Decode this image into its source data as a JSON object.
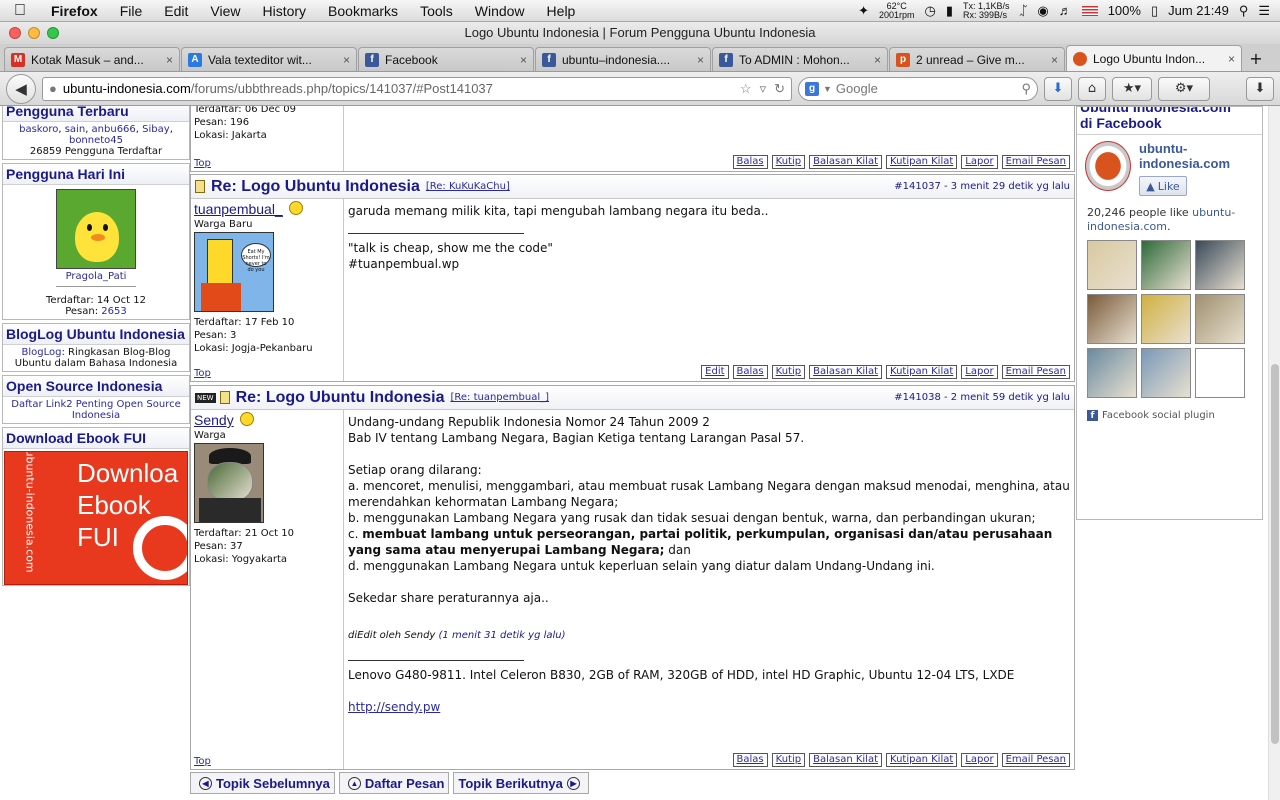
{
  "menubar": {
    "app": "Firefox",
    "items": [
      "File",
      "Edit",
      "View",
      "History",
      "Bookmarks",
      "Tools",
      "Window",
      "Help"
    ],
    "temp": "62°C",
    "rpm": "2001rpm",
    "tx_label": "Tx:",
    "tx": "1,1KB/s",
    "rx_label": "Rx:",
    "rx": "399B/s",
    "battery": "100%",
    "clock": "Jum 21:49"
  },
  "window": {
    "title": "Logo Ubuntu Indonesia | Forum Pengguna Ubuntu Indonesia"
  },
  "tabs": [
    {
      "label": "Kotak Masuk – and...",
      "fav": "M",
      "color": "#d93025"
    },
    {
      "label": "Vala texteditor wit...",
      "fav": "A",
      "color": "#2a7ae2"
    },
    {
      "label": "Facebook",
      "fav": "f",
      "color": "#3b5998"
    },
    {
      "label": "ubuntu–indonesia....",
      "fav": "f",
      "color": "#3b5998"
    },
    {
      "label": "To ADMIN : Mohon...",
      "fav": "f",
      "color": "#3b5998"
    },
    {
      "label": "2 unread – Give m...",
      "fav": "p",
      "color": "#d8531e"
    },
    {
      "label": "Logo Ubuntu Indon...",
      "fav": "",
      "color": "#d8531e"
    }
  ],
  "nav": {
    "url_domain": "ubuntu-indonesia.com",
    "url_path": "/forums/ubbthreads.php/topics/141037/#Post141037",
    "search_placeholder": "Google"
  },
  "left": {
    "newest": {
      "title": "Pengguna Terbaru",
      "users": [
        "baskoro",
        "sain",
        "anbu666",
        "Sibay",
        "bonneto45"
      ],
      "count": "26859 Pengguna Terdaftar"
    },
    "today": {
      "title": "Pengguna Hari Ini",
      "user": "Pragola_Pati",
      "joined": "Terdaftar: 14 Oct 12",
      "posts_label": "Pesan:",
      "posts": "2653"
    },
    "bloglog": {
      "title": "BlogLog Ubuntu Indonesia",
      "link": "BlogLog",
      "text": ": Ringkasan Blog-Blog Ubuntu dalam Bahasa Indonesia"
    },
    "opensource": {
      "title": "Open Source Indonesia",
      "link": "Daftar Link2 Penting Open Source Indonesia"
    },
    "ebook": {
      "title": "Download Ebook FUI",
      "line1": "Downloa",
      "line2": "Ebook",
      "line3": "FUI",
      "side": "ubuntu-indonesia.com"
    }
  },
  "post0": {
    "joined": "Terdaftar: 06 Dec 09",
    "posts": "Pesan: 196",
    "location": "Lokasi: Jakarta",
    "top": "Top"
  },
  "post1": {
    "title": "Re: Logo Ubuntu Indonesia",
    "reply": "[Re: KuKuKaChu]",
    "meta": "#141037 - 3 menit 29 detik yg lalu",
    "user": "tuanpembual_",
    "rank": "Warga Baru",
    "joined": "Terdaftar: 17 Feb 10",
    "posts": "Pesan: 3",
    "location": "Lokasi: Jogja-Pekanbaru",
    "body": "garuda memang milik kita, tapi mengubah lambang negara itu beda..",
    "sig1": "\"talk is cheap, show me the code\"",
    "sig2": "#tuanpembual.wp",
    "avatar_text": "Eat My Shorts! I'm never to do you",
    "top": "Top"
  },
  "post2": {
    "title": "Re: Logo Ubuntu Indonesia",
    "reply": "[Re: tuanpembual_]",
    "meta": "#141038 - 2 menit 59 detik yg lalu",
    "new_badge": "NEW",
    "user": "Sendy",
    "rank": "Warga",
    "joined": "Terdaftar: 21 Oct 10",
    "posts": "Pesan: 37",
    "location": "Lokasi: Yogyakarta",
    "l1": "Undang-undang Republik Indonesia Nomor 24 Tahun 2009 2",
    "l2": "Bab IV tentang Lambang Negara, Bagian Ketiga tentang Larangan Pasal 57.",
    "l3": "Setiap orang dilarang:",
    "l4": "a. mencoret, menulisi, menggambari, atau membuat rusak Lambang Negara dengan maksud menodai, menghina, atau merendahkan kehormatan Lambang Negara;",
    "l5": "b. menggunakan Lambang Negara yang rusak dan tidak sesuai dengan bentuk, warna, dan perbandingan ukuran;",
    "l6_prefix": "c. ",
    "l6_bold": "membuat lambang untuk perseorangan, partai politik, perkumpulan, organisasi dan/atau perusahaan yang sama atau menyerupai Lambang Negara;",
    "l6_suffix": " dan",
    "l7": "d. menggunakan Lambang Negara untuk keperluan selain yang diatur dalam Undang-Undang ini.",
    "l8": "Sekedar share peraturannya aja..",
    "edit_prefix": "diEdit oleh Sendy ",
    "edit_time": "(1 menit 31 detik yg lalu)",
    "sig1": "Lenovo G480-9811. Intel Celeron B830, 2GB of RAM, 320GB of HDD, intel HD Graphic, Ubuntu 12-04 LTS, LXDE",
    "sig2": "http://sendy.pw",
    "top": "Top"
  },
  "actions": {
    "edit": "Edit",
    "balas": "Balas",
    "kutip": "Kutip",
    "balasan_kilat": "Balasan Kilat",
    "kutipan_kilat": "Kutipan Kilat",
    "lapor": "Lapor",
    "email": "Email Pesan"
  },
  "bottomnav": {
    "prev": "Topik Sebelumnya",
    "list": "Daftar Pesan",
    "next": "Topik Berikutnya"
  },
  "facebook": {
    "title_top": "Ubuntu Indonesia.com",
    "title": "di Facebook",
    "page_name": "ubuntu-indonesia.com",
    "like": "Like",
    "count_prefix": "20,246 people like ",
    "count_link": "ubuntu-indonesia.com",
    "count_suffix": ".",
    "plugin": "Facebook social plugin",
    "face_colors": [
      "#4a6a3a",
      "#d9c9a0",
      "#2f6a3a",
      "#3a4a5a",
      "#7a5a3a",
      "#d0b040",
      "#a09070",
      "#6a8aa0",
      "#7a98b8"
    ]
  }
}
